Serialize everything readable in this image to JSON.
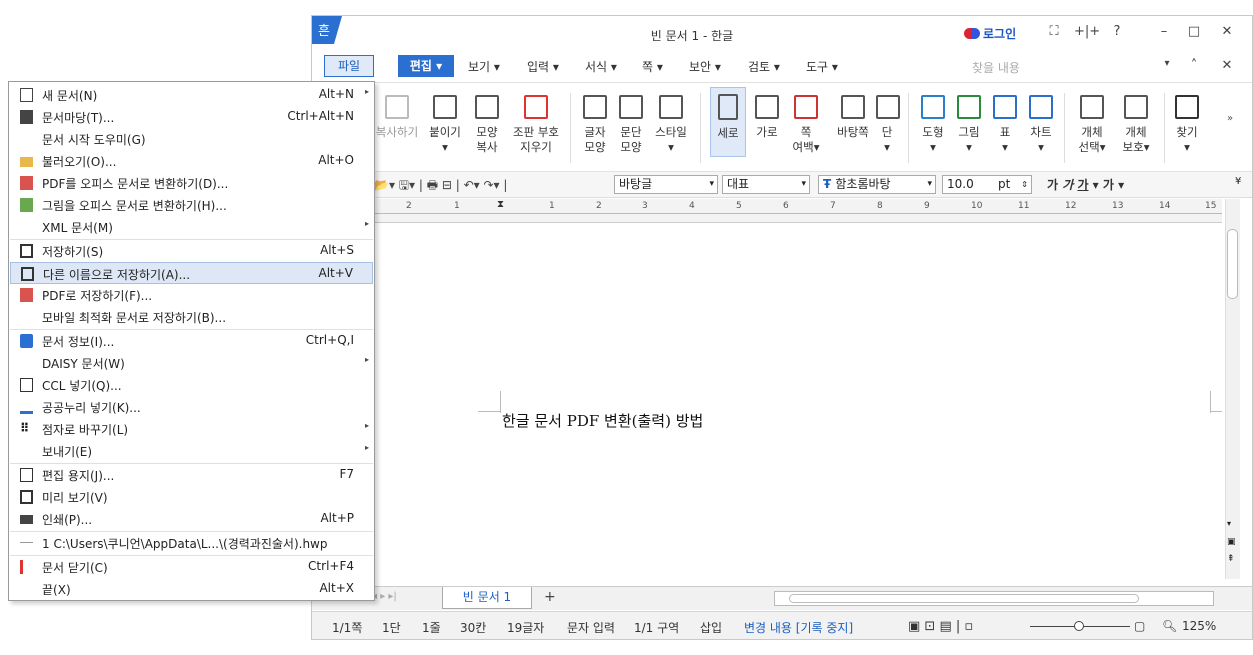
{
  "title": "빈 문서 1 - 한글",
  "login": "로그인",
  "menubar": {
    "file": "파일",
    "edit": "편집",
    "items": [
      "보기",
      "입력",
      "서식",
      "쪽",
      "보안",
      "검토",
      "도구"
    ],
    "find_placeholder": "찾을 내용"
  },
  "ribbon": {
    "buttons": [
      {
        "label": "복사하기"
      },
      {
        "label": "붙이기"
      },
      {
        "label": "모양",
        "label2": "복사"
      },
      {
        "label": "조판 부호",
        "label2": "지우기"
      },
      {
        "label": "글자",
        "label2": "모양"
      },
      {
        "label": "문단",
        "label2": "모양"
      },
      {
        "label": "스타일"
      },
      {
        "label": "세로"
      },
      {
        "label": "가로"
      },
      {
        "label": "쪽",
        "label2": "여백"
      },
      {
        "label": "바탕쪽"
      },
      {
        "label": "단"
      },
      {
        "label": "도형"
      },
      {
        "label": "그림"
      },
      {
        "label": "표"
      },
      {
        "label": "차트"
      },
      {
        "label": "개체",
        "label2": "선택"
      },
      {
        "label": "개체",
        "label2": "보호"
      },
      {
        "label": "찾기"
      }
    ]
  },
  "format": {
    "style": "바탕글",
    "lang": "대표",
    "font": "함초롬바탕",
    "size": "10.0",
    "unit": "pt"
  },
  "ruler_numbers": [
    "2",
    "1",
    "1",
    "2",
    "3",
    "4",
    "5",
    "6",
    "7",
    "8",
    "9",
    "10",
    "11",
    "12",
    "13",
    "14",
    "15"
  ],
  "document": {
    "text": "한글 문서 PDF 변환(출력) 방법"
  },
  "tab": {
    "name": "빈 문서 1",
    "add": "+"
  },
  "status": {
    "page": "1/1쪽",
    "col": "1단",
    "line": "1줄",
    "pos": "30칸",
    "chars": "19글자",
    "mode": "문자 입력",
    "section": "1/1 구역",
    "insert": "삽입",
    "track": "변경 내용 [기록 중지]",
    "zoom": "125%"
  },
  "file_menu": [
    {
      "label": "새 문서(N)",
      "shortcut": "Alt+N",
      "submenu": true,
      "icon": "new-doc-icon"
    },
    {
      "label": "문서마당(T)...",
      "shortcut": "Ctrl+Alt+N",
      "icon": "template-icon"
    },
    {
      "label": "문서 시작 도우미(G)",
      "shortcut": ""
    },
    {
      "label": "불러오기(O)...",
      "shortcut": "Alt+O",
      "icon": "open-folder-icon"
    },
    {
      "label": "PDF를 오피스 문서로 변환하기(D)...",
      "shortcut": "",
      "icon": "pdf-convert-icon"
    },
    {
      "label": "그림을 오피스 문서로 변환하기(H)...",
      "shortcut": "",
      "icon": "image-convert-icon"
    },
    {
      "label": "XML 문서(M)",
      "shortcut": "",
      "submenu": true
    },
    {
      "label": "저장하기(S)",
      "shortcut": "Alt+S",
      "icon": "save-icon"
    },
    {
      "label": "다른 이름으로 저장하기(A)...",
      "shortcut": "Alt+V",
      "icon": "save-as-icon",
      "highlighted": true
    },
    {
      "label": "PDF로 저장하기(F)...",
      "shortcut": "",
      "icon": "save-pdf-icon"
    },
    {
      "label": "모바일 최적화 문서로 저장하기(B)...",
      "shortcut": ""
    },
    {
      "label": "문서 정보(I)...",
      "shortcut": "Ctrl+Q,I",
      "icon": "info-icon"
    },
    {
      "label": "DAISY 문서(W)",
      "shortcut": "",
      "submenu": true
    },
    {
      "label": "CCL 넣기(Q)...",
      "shortcut": "",
      "icon": "ccl-icon"
    },
    {
      "label": "공공누리 넣기(K)...",
      "shortcut": "",
      "icon": "open-license-icon"
    },
    {
      "label": "점자로 바꾸기(L)",
      "shortcut": "",
      "submenu": true,
      "icon": "braille-icon"
    },
    {
      "label": "보내기(E)",
      "shortcut": "",
      "submenu": true
    },
    {
      "label": "편집 용지(J)...",
      "shortcut": "F7",
      "icon": "page-setup-icon"
    },
    {
      "label": "미리 보기(V)",
      "shortcut": "",
      "icon": "preview-icon"
    },
    {
      "label": "인쇄(P)...",
      "shortcut": "Alt+P",
      "icon": "print-icon"
    },
    {
      "label": "1 C:\\Users\\쿠니언\\AppData\\L...\\(경력과진술서).hwp",
      "shortcut": "",
      "icon": "recent-file-icon"
    },
    {
      "label": "문서 닫기(C)",
      "shortcut": "Ctrl+F4",
      "icon": "close-doc-icon"
    },
    {
      "label": "끝(X)",
      "shortcut": "Alt+X"
    }
  ]
}
